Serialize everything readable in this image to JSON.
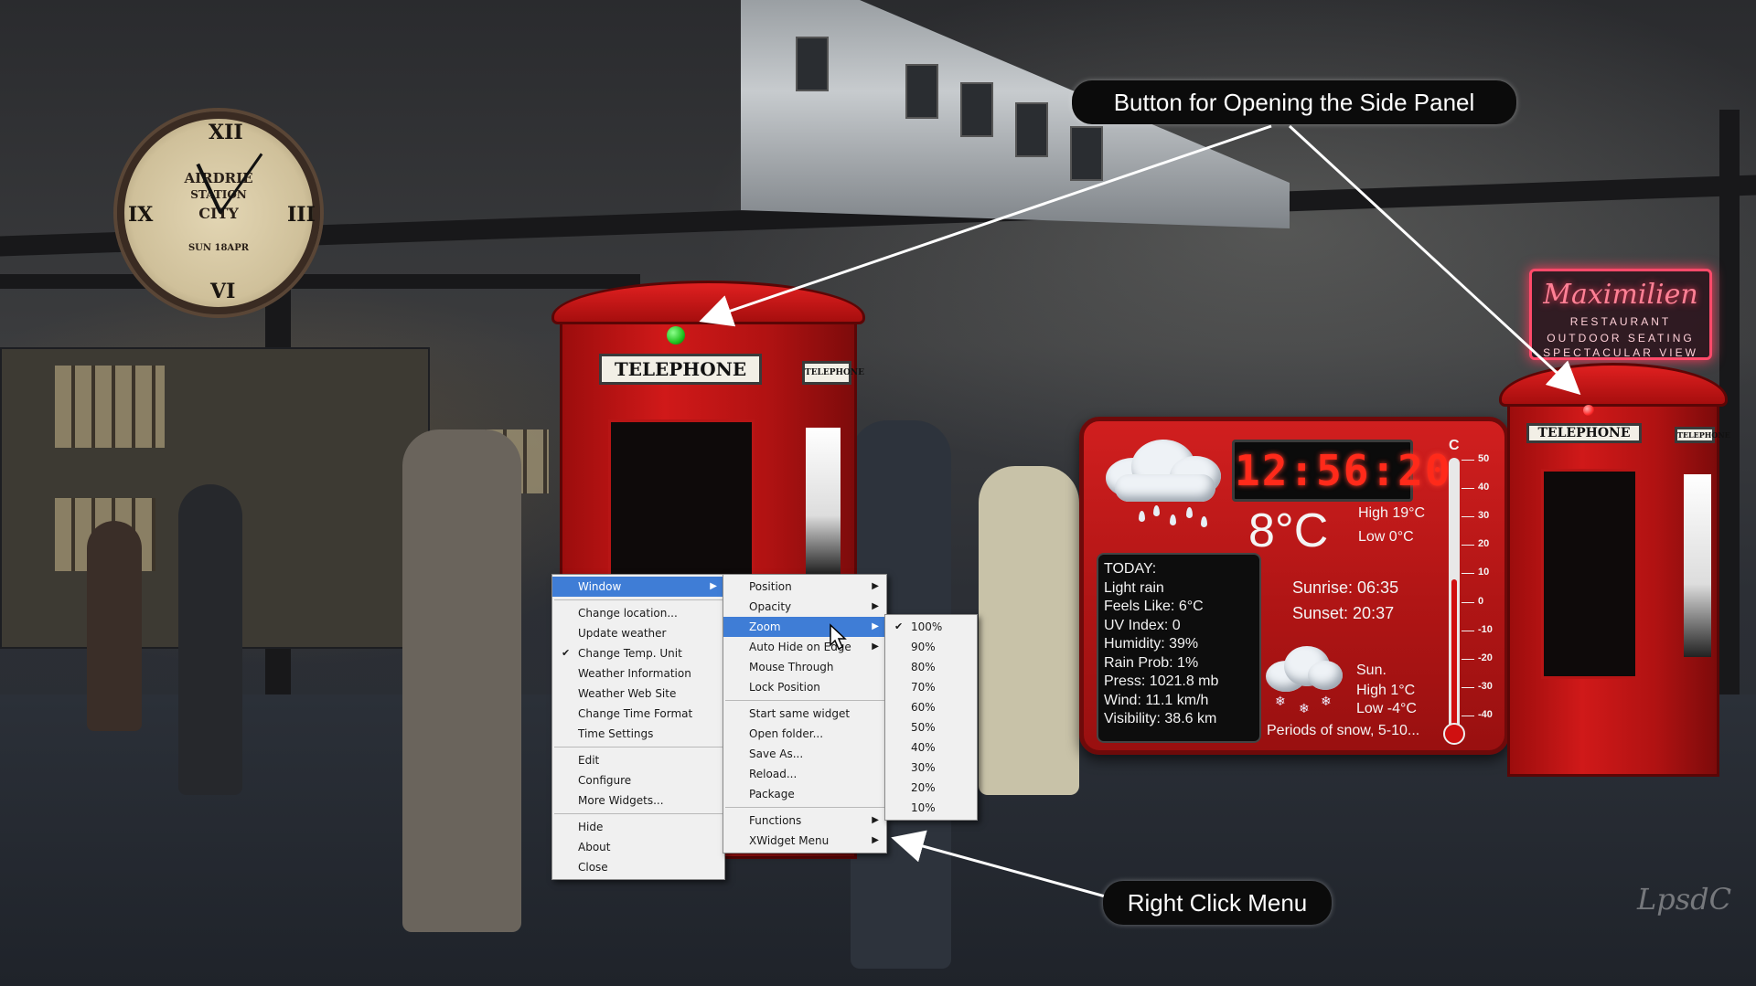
{
  "scene": {
    "clock_face": {
      "line1": "AIRDRIE",
      "line2": "STATION",
      "line3": "CITY",
      "date": "SUN 18APR"
    },
    "booth_sign": "TELEPHONE",
    "booth_side_sign": "TELEPHONE",
    "restaurant": {
      "name": "Maximilien",
      "line2": "RESTAURANT",
      "line3": "OUTDOOR SEATING",
      "line4": "SPECTACULAR VIEW"
    },
    "signature": "LpsdC",
    "colors": {
      "booth_red": "#c41616",
      "led_green": "#1fc21f",
      "led_red": "#ff2a2a",
      "menu_highlight": "#3f7dd6"
    }
  },
  "callouts": {
    "side_panel": "Button for Opening the Side Panel",
    "right_click": "Right Click Menu"
  },
  "weather": {
    "time": "12:56:20",
    "temperature": "8°C",
    "high": "High 19°C",
    "low": "Low 0°C",
    "today": [
      "TODAY:",
      "Light rain",
      "Feels Like: 6°C",
      "UV Index: 0",
      "Humidity: 39%",
      "Rain Prob:  1%",
      "Press:  1021.8 mb",
      "Wind:  11.1 km/h",
      "Visibility: 38.6 km"
    ],
    "sunrise": "Sunrise: 06:35",
    "sunset": "Sunset: 20:37",
    "forecast_day": "Sun.",
    "forecast_high": "High 1°C",
    "forecast_low": "Low -4°C",
    "forecast_summary": "Periods of snow, 5-10...",
    "thermometer_unit": "C",
    "thermometer_ticks": [
      "50",
      "40",
      "30",
      "20",
      "10",
      "0",
      "-10",
      "-20",
      "-30",
      "-40"
    ],
    "thermometer_level_celsius": 8,
    "icons": {
      "today": "rain-cloud-icon",
      "forecast": "snow-cloud-icon"
    }
  },
  "menus": {
    "main": {
      "items": [
        "Window",
        "Change location...",
        "Update weather",
        "Change Temp. Unit",
        "Weather Information",
        "Weather Web Site",
        "Change Time Format",
        "Time Settings",
        "Edit",
        "Configure",
        "More Widgets...",
        "Hide",
        "About",
        "Close"
      ],
      "highlighted": "Window",
      "checked": "Change Temp. Unit"
    },
    "window": {
      "items": [
        "Position",
        "Opacity",
        "Zoom",
        "Auto Hide on Edge",
        "Mouse Through",
        "Lock Position",
        "Start same widget",
        "Open folder...",
        "Save As...",
        "Reload...",
        "Package",
        "Functions",
        "XWidget Menu"
      ],
      "highlighted": "Zoom"
    },
    "zoom": {
      "items": [
        "100%",
        "90%",
        "80%",
        "70%",
        "60%",
        "50%",
        "40%",
        "30%",
        "20%",
        "10%"
      ],
      "checked": "100%"
    }
  }
}
